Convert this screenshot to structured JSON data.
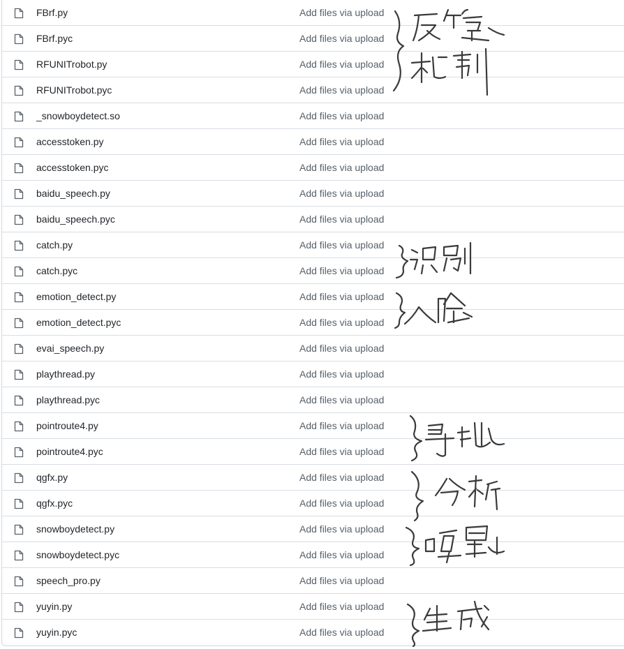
{
  "files": [
    {
      "name": "FBrf.py",
      "commit": "Add files via upload",
      "icon": "file-icon"
    },
    {
      "name": "FBrf.pyc",
      "commit": "Add files via upload",
      "icon": "file-icon"
    },
    {
      "name": "RFUNITrobot.py",
      "commit": "Add files via upload",
      "icon": "file-icon"
    },
    {
      "name": "RFUNITrobot.pyc",
      "commit": "Add files via upload",
      "icon": "file-icon"
    },
    {
      "name": "_snowboydetect.so",
      "commit": "Add files via upload",
      "icon": "file-icon"
    },
    {
      "name": "accesstoken.py",
      "commit": "Add files via upload",
      "icon": "file-icon"
    },
    {
      "name": "accesstoken.pyc",
      "commit": "Add files via upload",
      "icon": "file-icon"
    },
    {
      "name": "baidu_speech.py",
      "commit": "Add files via upload",
      "icon": "file-icon"
    },
    {
      "name": "baidu_speech.pyc",
      "commit": "Add files via upload",
      "icon": "file-icon"
    },
    {
      "name": "catch.py",
      "commit": "Add files via upload",
      "icon": "file-icon"
    },
    {
      "name": "catch.pyc",
      "commit": "Add files via upload",
      "icon": "file-icon"
    },
    {
      "name": "emotion_detect.py",
      "commit": "Add files via upload",
      "icon": "file-icon"
    },
    {
      "name": "emotion_detect.pyc",
      "commit": "Add files via upload",
      "icon": "file-icon"
    },
    {
      "name": "evai_speech.py",
      "commit": "Add files via upload",
      "icon": "file-icon"
    },
    {
      "name": "playthread.py",
      "commit": "Add files via upload",
      "icon": "file-icon"
    },
    {
      "name": "playthread.pyc",
      "commit": "Add files via upload",
      "icon": "file-icon"
    },
    {
      "name": "pointroute4.py",
      "commit": "Add files via upload",
      "icon": "file-icon"
    },
    {
      "name": "pointroute4.pyc",
      "commit": "Add files via upload",
      "icon": "file-icon"
    },
    {
      "name": "qgfx.py",
      "commit": "Add files via upload",
      "icon": "file-icon"
    },
    {
      "name": "qgfx.pyc",
      "commit": "Add files via upload",
      "icon": "file-icon"
    },
    {
      "name": "snowboydetect.py",
      "commit": "Add files via upload",
      "icon": "file-icon"
    },
    {
      "name": "snowboydetect.pyc",
      "commit": "Add files via upload",
      "icon": "file-icon"
    },
    {
      "name": "speech_pro.py",
      "commit": "Add files via upload",
      "icon": "file-icon"
    },
    {
      "name": "yuyin.py",
      "commit": "Add files via upload",
      "icon": "file-icon"
    },
    {
      "name": "yuyin.pyc",
      "commit": "Add files via upload",
      "icon": "file-icon"
    }
  ],
  "annotations": [
    {
      "text": "反馈机制"
    },
    {
      "text": "识别"
    },
    {
      "text": "人脸"
    },
    {
      "text": "导航"
    },
    {
      "text": "分析"
    },
    {
      "text": "唤醒"
    },
    {
      "text": "生成"
    }
  ],
  "colors": {
    "file_name": "#1f2328",
    "commit": "#57606a",
    "border": "#d8dee4",
    "icon": "#57606a",
    "handwriting": "#3a3a3a"
  }
}
